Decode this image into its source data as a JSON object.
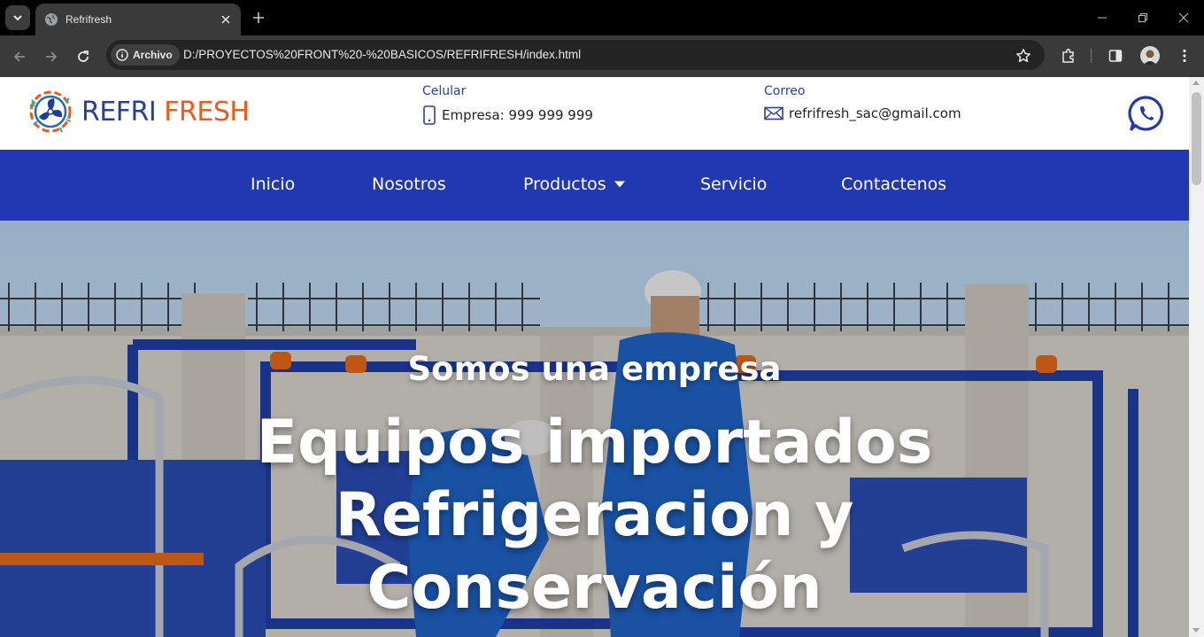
{
  "browser": {
    "tab_title": "Refrifresh",
    "security_chip": "Archivo",
    "url": "D:/PROYECTOS%20FRONT%20-%20BASICOS/REFRIFRESH/index.html"
  },
  "header": {
    "logo_part1": "REFRI",
    "logo_part2": "FRESH",
    "phone_label": "Celular",
    "phone_value": "Empresa: 999 999 999",
    "email_label": "Correo",
    "email_value": "refrifresh_sac@gmail.com",
    "whatsapp_icon": "whatsapp-icon"
  },
  "nav": {
    "items": [
      {
        "label": "Inicio"
      },
      {
        "label": "Nosotros"
      },
      {
        "label": "Productos",
        "has_dropdown": true
      },
      {
        "label": "Servicio"
      },
      {
        "label": "Contactenos"
      }
    ]
  },
  "hero": {
    "subtitle": "Somos una empresa",
    "title_lines": [
      "Equipos importados",
      "Refrigeracion y",
      "Conservación"
    ]
  },
  "colors": {
    "brand_blue": "#2238b0",
    "logo_blue": "#2a3d9e",
    "logo_orange": "#f05a14",
    "chrome_dark": "#3a3a3a"
  }
}
